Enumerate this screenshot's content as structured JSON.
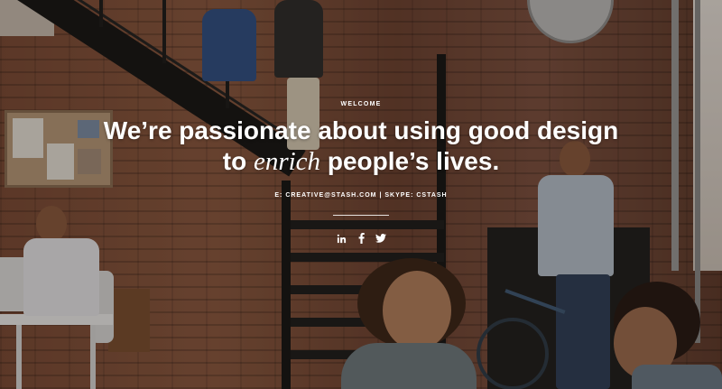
{
  "hero": {
    "eyebrow": "WELCOME",
    "headline_line1": "We’re passionate about using good design",
    "headline_line2_pre": "to ",
    "headline_line2_accent": "enrich",
    "headline_line2_post": " people’s lives.",
    "contact": "E: CREATIVE@STASH.COM  |  SKYPE: CSTASH"
  },
  "social": {
    "items": [
      {
        "name": "linkedin",
        "icon": "linkedin-icon",
        "label": "in"
      },
      {
        "name": "facebook",
        "icon": "facebook-icon",
        "label": "f"
      },
      {
        "name": "twitter",
        "icon": "twitter-icon",
        "label": "twitter"
      }
    ]
  },
  "colors": {
    "text": "#ffffff",
    "overlay": "#140c08",
    "brick": "#7a4a36"
  },
  "background": {
    "scene": "office-photo-brick-wall-staircase"
  }
}
